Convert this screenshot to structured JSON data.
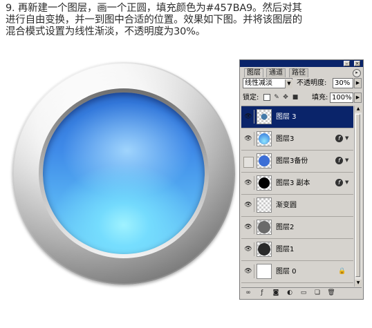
{
  "instruction": {
    "line1": "9. 再新建一个图层，画一个正圆，填充颜色为#457BA9。然后对其",
    "line2": "进行自由变换，并一到图中合适的位置。效果如下图。并将该图层的",
    "line3": "混合模式设置为线性渐淡，不透明度为30%。"
  },
  "panel": {
    "tabs": [
      "图层",
      "通道",
      "路径"
    ],
    "active_tab": "图层",
    "blend_mode": "线性减淡",
    "opacity_label": "不透明度:",
    "opacity_value": "30%",
    "lock_label": "锁定:",
    "fill_label": "填充:",
    "fill_value": "100%",
    "layers": [
      {
        "name": "图层 3",
        "selected": true,
        "visible": true,
        "thumb": "small-blue-circle"
      },
      {
        "name": "图层3",
        "selected": false,
        "visible": true,
        "thumb": "blue-gradient-circle",
        "fx": true
      },
      {
        "name": "图层3备份",
        "selected": false,
        "visible": false,
        "thumb": "blue-circle",
        "fx": true
      },
      {
        "name": "图层3 副本",
        "selected": false,
        "visible": true,
        "thumb": "black-circle",
        "fx": true
      },
      {
        "name": "渐变圆",
        "selected": false,
        "visible": true,
        "thumb": "transparent"
      },
      {
        "name": "图层2",
        "selected": false,
        "visible": true,
        "thumb": "gray-circle"
      },
      {
        "name": "图层1",
        "selected": false,
        "visible": true,
        "thumb": "dark-circle"
      },
      {
        "name": "图层 0",
        "selected": false,
        "visible": true,
        "thumb": "white",
        "locked": true
      }
    ],
    "icons": {
      "eye": "eye-icon",
      "fx": "layer-effects-icon",
      "lock": "lock-icon"
    }
  },
  "colors": {
    "titlebar": "#0a246a",
    "selection": "#0a246a",
    "panel_bg": "#d6d3ce",
    "orb_blue": "#457BA9"
  }
}
